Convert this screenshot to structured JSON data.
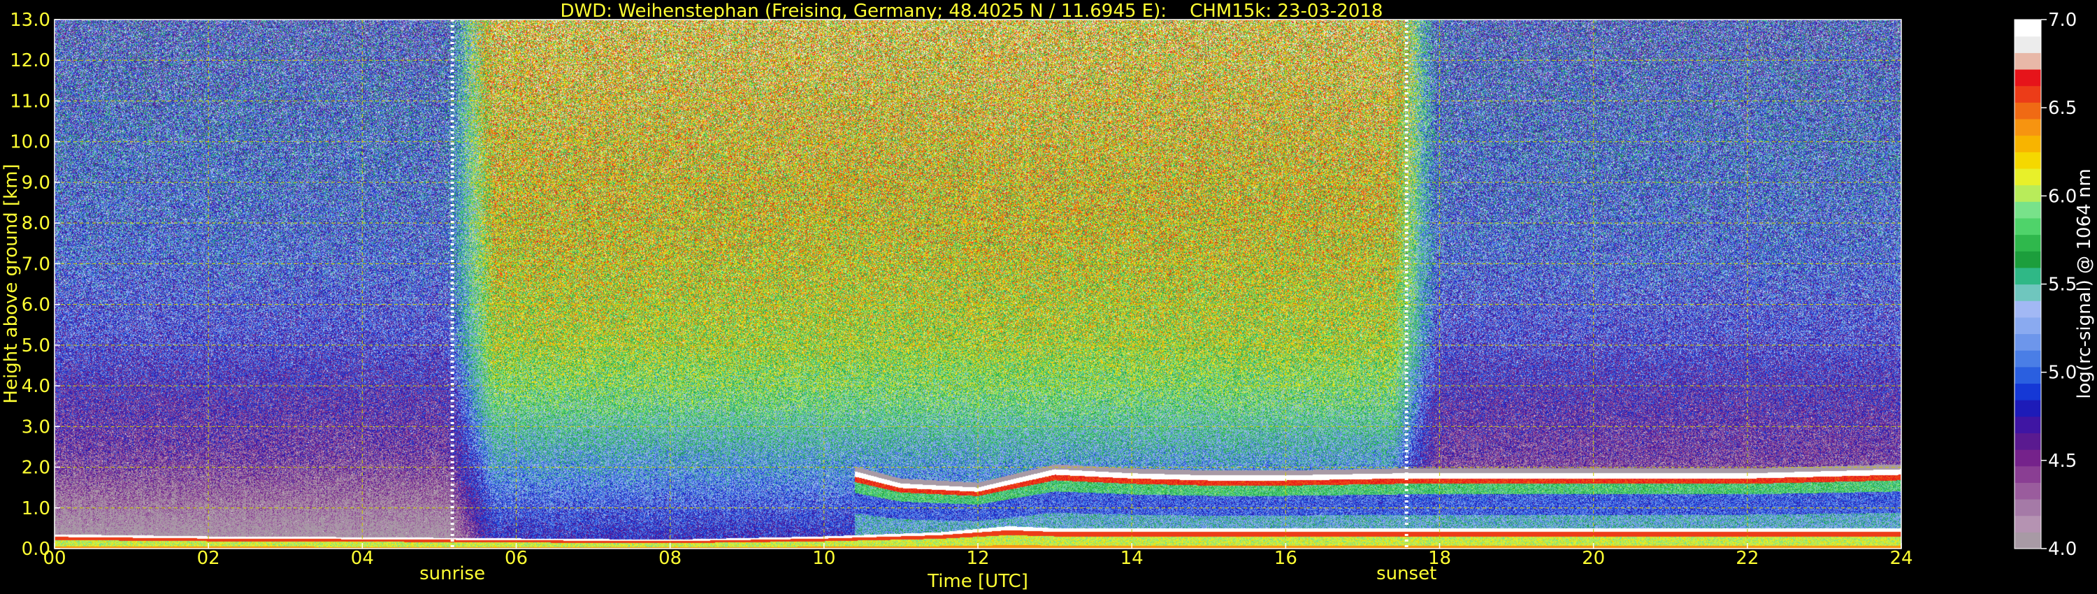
{
  "chart_data": {
    "type": "heatmap",
    "title": "DWD: Weihenstephan (Freising, Germany; 48.4025 N / 11.6945 E):    CHM15k: 23-03-2018",
    "xlabel": "Time [UTC]",
    "ylabel": "Height above ground [km]",
    "xlim": [
      0,
      24
    ],
    "ylim": [
      0,
      13
    ],
    "x_ticks": [
      "00",
      "02",
      "04",
      "06",
      "08",
      "10",
      "12",
      "14",
      "16",
      "18",
      "20",
      "22",
      "24"
    ],
    "y_ticks": [
      "0.0",
      "1.0",
      "2.0",
      "3.0",
      "4.0",
      "5.0",
      "6.0",
      "7.0",
      "8.0",
      "9.0",
      "10.0",
      "11.0",
      "12.0",
      "13.0"
    ],
    "x_grid_step": 2,
    "y_grid_step": 1,
    "grid": true,
    "grid_color": "#cccc00",
    "text_color": "#ffff33",
    "annotations": [
      {
        "label": "sunrise",
        "x": 5.17
      },
      {
        "label": "sunset",
        "x": 17.57
      }
    ],
    "colorbar": {
      "label": "log(rc-signal) @ 1064 nm",
      "min": 4.0,
      "max": 7.0,
      "ticks": [
        "4.0",
        "4.5",
        "5.0",
        "5.5",
        "6.0",
        "6.5",
        "7.0"
      ],
      "colors": [
        "#a89aa5",
        "#b593b2",
        "#a57aa7",
        "#9a5c9d",
        "#8a3e93",
        "#75228b",
        "#5a1a90",
        "#3f15a3",
        "#1d1bb8",
        "#1538d6",
        "#2a5fe0",
        "#4a7ee6",
        "#6d96eb",
        "#8aaaf0",
        "#a2b8f4",
        "#6fc6be",
        "#2fb886",
        "#1c9e3c",
        "#2fb84c",
        "#4fd36a",
        "#78e28a",
        "#b8ec5a",
        "#e8f02a",
        "#f5d800",
        "#f8b400",
        "#f79410",
        "#f06a14",
        "#ec3c18",
        "#e6141a",
        "#e8b8a8",
        "#ececec",
        "#ffffff"
      ]
    },
    "features": {
      "background_rows": [
        {
          "h": 13.0,
          "night": 5.0,
          "day": 6.3
        },
        {
          "h": 10.0,
          "night": 5.1,
          "day": 6.2
        },
        {
          "h": 7.0,
          "night": 5.05,
          "day": 6.1
        },
        {
          "h": 5.0,
          "night": 4.9,
          "day": 6.0
        },
        {
          "h": 3.5,
          "night": 4.6,
          "day": 5.7
        },
        {
          "h": 2.2,
          "night": 4.45,
          "day": 5.3
        }
      ],
      "daylight": {
        "start": 5.7,
        "end": 17.4,
        "ramp": 0.6
      },
      "surface_layer": [
        {
          "t": 0.0,
          "top": 0.35
        },
        {
          "t": 2.0,
          "top": 0.3
        },
        {
          "t": 4.0,
          "top": 0.28
        },
        {
          "t": 6.0,
          "top": 0.25
        },
        {
          "t": 8.0,
          "top": 0.22
        },
        {
          "t": 10.0,
          "top": 0.3
        },
        {
          "t": 11.5,
          "top": 0.4
        },
        {
          "t": 12.4,
          "top": 0.55
        },
        {
          "t": 13.0,
          "top": 0.5
        }
      ],
      "boundary_layer": [
        {
          "t": 10.4,
          "top": 1.9
        },
        {
          "t": 11.0,
          "top": 1.6
        },
        {
          "t": 12.0,
          "top": 1.5
        },
        {
          "t": 13.0,
          "top": 1.95
        },
        {
          "t": 14.0,
          "top": 1.85
        },
        {
          "t": 15.0,
          "top": 1.8
        },
        {
          "t": 16.0,
          "top": 1.8
        },
        {
          "t": 17.5,
          "top": 1.85
        },
        {
          "t": 20.0,
          "top": 1.85
        },
        {
          "t": 22.0,
          "top": 1.85
        },
        {
          "t": 24.0,
          "top": 1.95
        }
      ]
    }
  }
}
